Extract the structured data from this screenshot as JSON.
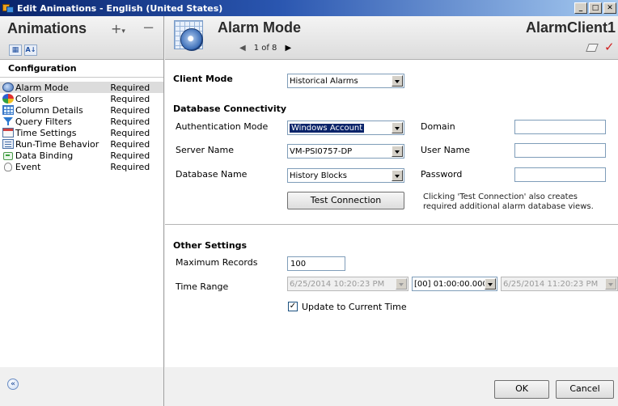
{
  "window": {
    "title": "Edit Animations - English (United States)"
  },
  "left": {
    "title": "Animations",
    "plus": "+",
    "plus_caret": "▾",
    "minus": "−",
    "sort_icons": [
      "categorized-view-icon",
      "alphabetical-sort-icon"
    ],
    "section": "Configuration",
    "items": [
      {
        "name": "Alarm Mode",
        "status": "Required",
        "icon": "alarm-mode-icon",
        "selected": true
      },
      {
        "name": "Colors",
        "status": "Required",
        "icon": "colors-icon"
      },
      {
        "name": "Column Details",
        "status": "Required",
        "icon": "column-details-icon"
      },
      {
        "name": "Query Filters",
        "status": "Required",
        "icon": "query-filter-icon"
      },
      {
        "name": "Time Settings",
        "status": "Required",
        "icon": "time-settings-icon"
      },
      {
        "name": "Run-Time Behavior",
        "status": "Required",
        "icon": "run-time-behavior-icon"
      },
      {
        "name": "Data Binding",
        "status": "Required",
        "icon": "data-binding-icon"
      },
      {
        "name": "Event",
        "status": "Required",
        "icon": "event-icon"
      }
    ]
  },
  "header": {
    "title": "Alarm Mode",
    "pager": "1 of 8",
    "client": "AlarmClient1"
  },
  "client_mode": {
    "label": "Client Mode",
    "value": "Historical Alarms"
  },
  "db": {
    "heading": "Database Connectivity",
    "auth_label": "Authentication Mode",
    "auth_value": "Windows Account",
    "server_label": "Server Name",
    "server_value": "VM-PSI0757-DP",
    "dbname_label": "Database Name",
    "dbname_value": "History Blocks",
    "domain_label": "Domain",
    "domain_value": "",
    "user_label": "User Name",
    "user_value": "",
    "password_label": "Password",
    "password_value": "",
    "test_button": "Test Connection",
    "note": "Clicking 'Test Connection' also creates required additional alarm database views."
  },
  "other": {
    "heading": "Other Settings",
    "max_label": "Maximum Records",
    "max_value": "100",
    "time_label": "Time Range",
    "time_start": "6/25/2014 10:20:23 PM",
    "duration": "[00] 01:00:00.000",
    "time_end": "6/25/2014 11:20:23 PM",
    "update_label": "Update to Current Time",
    "update_checked": true
  },
  "footer": {
    "ok": "OK",
    "cancel": "Cancel"
  },
  "colors": {
    "titlebar": "#0a246a",
    "selection": "#0a246a",
    "checkmark": "#d02020"
  }
}
